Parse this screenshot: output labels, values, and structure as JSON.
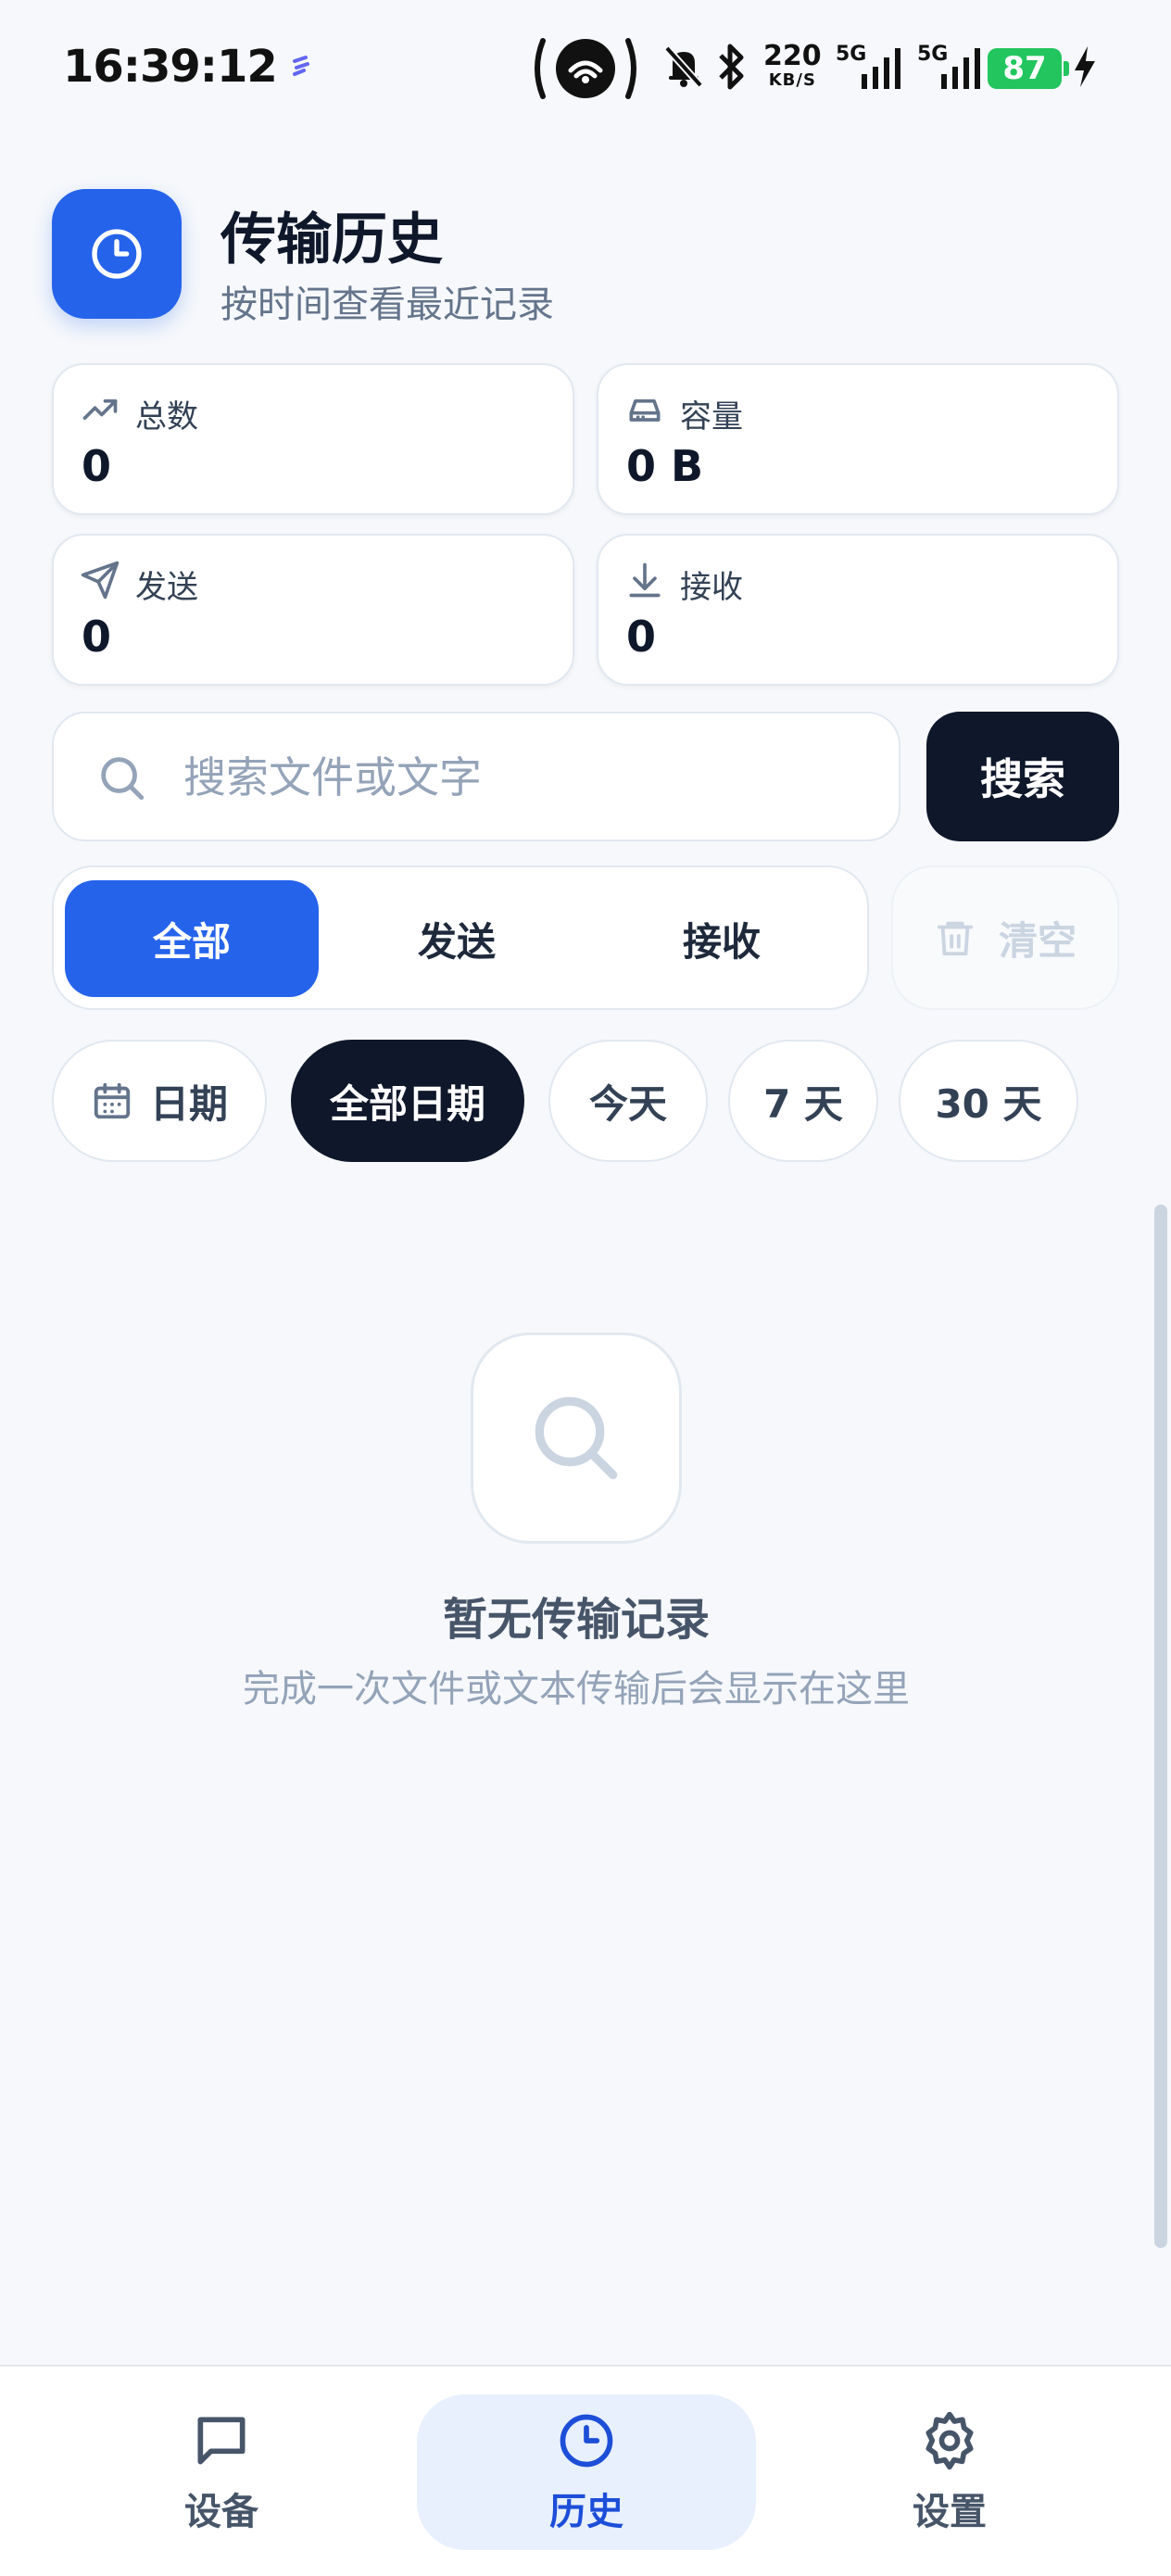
{
  "status_bar": {
    "time": "16:39:12",
    "net_speed_value": "220",
    "net_speed_unit": "KB/S",
    "signal1_label": "5G",
    "signal2_label": "5G",
    "battery": "87"
  },
  "header": {
    "title": "传输历史",
    "subtitle": "按时间查看最近记录",
    "icon": "clock-icon"
  },
  "stats": [
    {
      "label": "总数",
      "value": "0",
      "icon": "trending-up-icon"
    },
    {
      "label": "容量",
      "value": "0 B",
      "icon": "hard-drive-icon"
    },
    {
      "label": "发送",
      "value": "0",
      "icon": "send-icon"
    },
    {
      "label": "接收",
      "value": "0",
      "icon": "download-icon"
    }
  ],
  "search": {
    "placeholder": "搜索文件或文字",
    "value": "",
    "button_label": "搜索"
  },
  "filter_tabs": {
    "items": [
      "全部",
      "发送",
      "接收"
    ],
    "selected": "全部"
  },
  "clear_button": {
    "label": "清空"
  },
  "date_filters": {
    "date_label": "日期",
    "options": [
      "全部日期",
      "今天",
      "7 天",
      "30 天"
    ],
    "selected": "全部日期"
  },
  "empty_state": {
    "title": "暂无传输记录",
    "subtitle": "完成一次文件或文本传输后会显示在这里"
  },
  "bottom_nav": {
    "items": [
      {
        "label": "设备",
        "icon": "message-square-icon"
      },
      {
        "label": "历史",
        "icon": "clock-icon"
      },
      {
        "label": "设置",
        "icon": "gear-icon"
      }
    ],
    "selected": "历史"
  },
  "colors": {
    "accent": "#2563eb",
    "dark": "#0f172a",
    "background": "#f6f8fb"
  }
}
